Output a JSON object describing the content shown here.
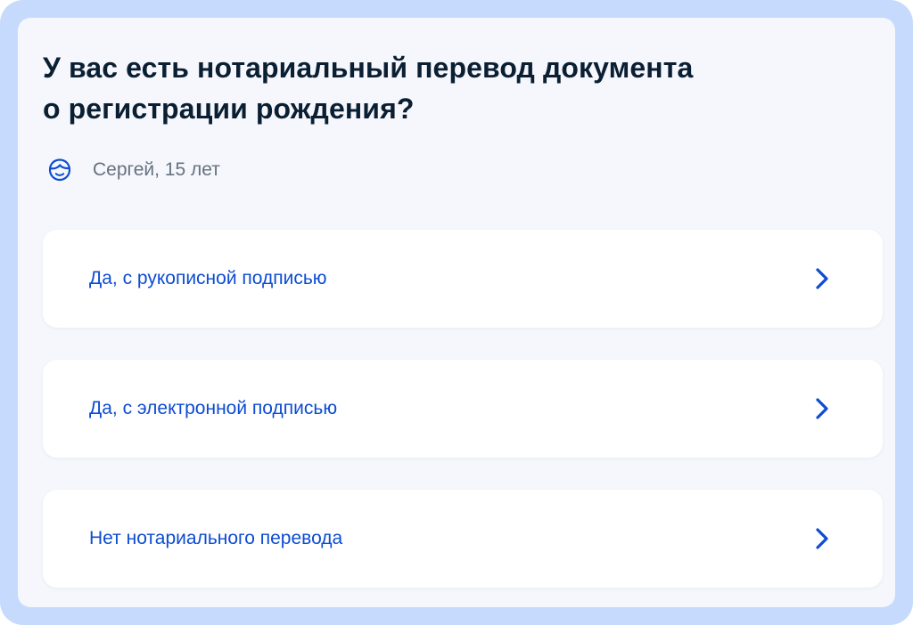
{
  "question": {
    "line1": "У вас есть нотариальный перевод документа",
    "line2": "о регистрации рождения?"
  },
  "person": {
    "icon": "child-face-icon",
    "name": "Сергей, 15 лет"
  },
  "options": [
    {
      "label": "Да, с рукописной подписью",
      "icon": "chevron-right-icon"
    },
    {
      "label": "Да, с электронной подписью",
      "icon": "chevron-right-icon"
    },
    {
      "label": "Нет нотариального перевода",
      "icon": "chevron-right-icon"
    }
  ],
  "colors": {
    "frame": "#c5dafd",
    "panel": "#f5f7fc",
    "title": "#0b1f33",
    "muted": "#66727f",
    "accent": "#0d4cd3"
  }
}
